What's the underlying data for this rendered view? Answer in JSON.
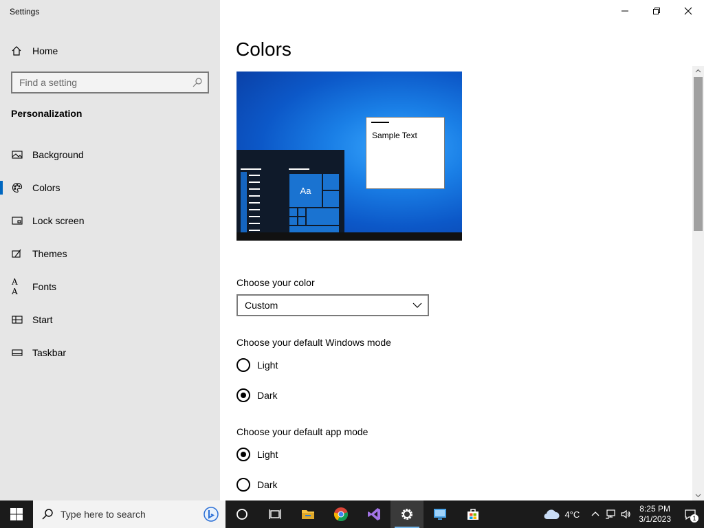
{
  "app": {
    "title": "Settings"
  },
  "sidebar": {
    "home_label": "Home",
    "search_placeholder": "Find a setting",
    "section_title": "Personalization",
    "items": [
      {
        "label": "Background",
        "icon": "image-icon"
      },
      {
        "label": "Colors",
        "icon": "palette-icon",
        "active": true
      },
      {
        "label": "Lock screen",
        "icon": "lock-screen-icon"
      },
      {
        "label": "Themes",
        "icon": "themes-icon"
      },
      {
        "label": "Fonts",
        "icon": "fonts-icon",
        "glyph": "A A"
      },
      {
        "label": "Start",
        "icon": "start-icon"
      },
      {
        "label": "Taskbar",
        "icon": "taskbar-icon"
      }
    ]
  },
  "main": {
    "title": "Colors",
    "preview": {
      "sample_text": "Sample Text",
      "tile_text": "Aa"
    },
    "choose_color": {
      "label": "Choose your color",
      "value": "Custom"
    },
    "windows_mode": {
      "label": "Choose your default Windows mode",
      "options": [
        {
          "label": "Light",
          "selected": false
        },
        {
          "label": "Dark",
          "selected": true
        }
      ]
    },
    "app_mode": {
      "label": "Choose your default app mode",
      "options": [
        {
          "label": "Light",
          "selected": true
        },
        {
          "label": "Dark",
          "selected": false
        }
      ]
    }
  },
  "taskbar": {
    "search_placeholder": "Type here to search",
    "apps": [
      "cortana-icon",
      "task-view-icon",
      "file-explorer-icon",
      "chrome-icon",
      "visual-studio-icon",
      "settings-icon",
      "remote-desktop-icon",
      "store-icon"
    ],
    "weather": "4°C",
    "time": "8:25 PM",
    "date": "3/1/2023",
    "notification_count": "1"
  },
  "colors": {
    "accent": "#0067c0",
    "sidebar_bg": "#e6e6e6",
    "taskbar_bg": "#1b1b1b"
  }
}
